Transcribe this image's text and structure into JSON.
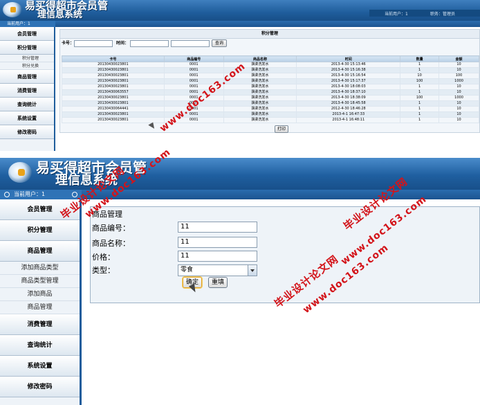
{
  "shot1": {
    "app_title_line1": "易买得超市会员管",
    "app_title_line2": "理信息系统",
    "current_user_label": "当前用户：1",
    "role_label": "职务：管理员",
    "sidebar_header": "当前用户：1",
    "sidebar": {
      "items": [
        {
          "label": "会员管理"
        },
        {
          "label": "积分管理"
        },
        {
          "label": "商品管理"
        },
        {
          "label": "消费管理"
        },
        {
          "label": "查询统计"
        },
        {
          "label": "系统设置"
        },
        {
          "label": "修改密码"
        }
      ],
      "sub_items": [
        "积分管理",
        "积分兑换"
      ]
    },
    "panel_title": "积分管理",
    "filters": {
      "card_label": "卡号：",
      "time_label": "时间：",
      "search_button": "查询"
    },
    "table": {
      "columns": [
        "卡号",
        "商品编号",
        "商品名称",
        "时间",
        "数量",
        "金额"
      ],
      "rows": [
        [
          "20130430023801",
          "0001",
          "飘柔洗发水",
          "2013-4-30 15:13:46",
          "1",
          "10"
        ],
        [
          "20130430023801",
          "0001",
          "飘柔洗发水",
          "2013-4-30 15:16:38",
          "1",
          "10"
        ],
        [
          "20130430023801",
          "0001",
          "飘柔洗发水",
          "2013-4-30 15:16:54",
          "10",
          "100"
        ],
        [
          "20130430023801",
          "0001",
          "飘柔洗发水",
          "2013-4-30 15:17:37",
          "100",
          "1000"
        ],
        [
          "20130430023801",
          "0001",
          "飘柔洗发水",
          "2013-4-30 18:08:03",
          "1",
          "10"
        ],
        [
          "20130430063557",
          "0001",
          "飘柔洗发水",
          "2013-4-30 18:37:10",
          "1",
          "10"
        ],
        [
          "20130430023801",
          "0001",
          "飘柔洗发水",
          "2013-4-30 18:38:09",
          "100",
          "1000"
        ],
        [
          "20130430023801",
          "0001",
          "飘柔洗发水",
          "2013-4-30 18:45:58",
          "1",
          "10"
        ],
        [
          "20130430064441",
          "0001",
          "飘柔洗发水",
          "2012-4-30 18:46:28",
          "1",
          "10"
        ],
        [
          "20130430023801",
          "0001",
          "飘柔洗发水",
          "2013-4-1 16:47:33",
          "1",
          "10"
        ],
        [
          "20130430023801",
          "0001",
          "飘柔洗发水",
          "2013-4-1 16:48:11",
          "1",
          "10"
        ]
      ]
    },
    "print_button": "打印"
  },
  "shot2": {
    "app_title_line1": "易买得超市会员管",
    "app_title_line2": "理信息系统",
    "sidebar_header": "当前用户：1",
    "sidebar": {
      "top_items": [
        "会员管理",
        "积分管理",
        "商品管理"
      ],
      "sub_items": [
        "添加商品类型",
        "商品类型管理",
        "添加商品",
        "商品管理"
      ],
      "bottom_items": [
        "消费管理",
        "查询统计",
        "系统设置",
        "修改密码"
      ]
    },
    "form": {
      "title": "商品管理",
      "code_label": "商品编号：",
      "code_value": "11",
      "name_label": "商品名称：",
      "name_value": "11",
      "price_label": "价格：",
      "price_value": "11",
      "type_label": "类型：",
      "type_value": "零食",
      "ok_button": "确定",
      "reset_button": "重填"
    }
  },
  "watermarks": {
    "url": "www.doc163.com",
    "cn": "毕业设计论文网"
  },
  "colors": {
    "banner": "#1f5d9c",
    "watermark": "#d3141a"
  }
}
